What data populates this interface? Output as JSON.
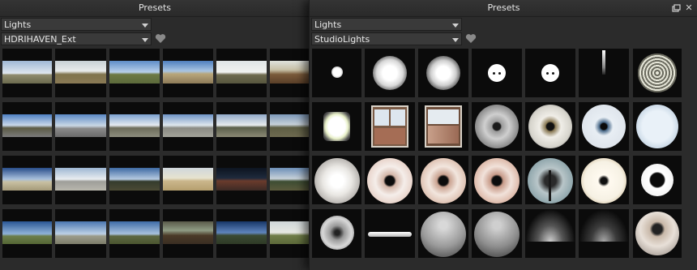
{
  "left_panel": {
    "title": "Presets",
    "category_dropdown": "Lights",
    "preset_dropdown": "HDRIHAVEN_Ext",
    "favorite_icon": "heart-icon"
  },
  "right_panel": {
    "title": "Presets",
    "category_dropdown": "Lights",
    "preset_dropdown": "StudioLights",
    "favorite_icon": "heart-icon",
    "float_icon": "float-window-icon",
    "close_icon": "close-icon",
    "close_label": "✕"
  },
  "colors": {
    "panel_bg": "#2b2b2b",
    "titlebar_bg": "#2f2f2f",
    "dropdown_bg": "#3a3a3a",
    "thumb_bg": "#0b0b0b",
    "text": "#d9d9d9"
  }
}
